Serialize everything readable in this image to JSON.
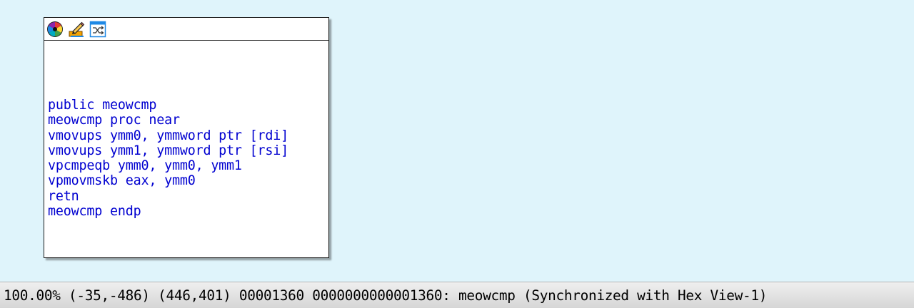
{
  "graph": {
    "node": {
      "header_icons": [
        "color-wheel-icon",
        "edit-pencil-icon",
        "graph-layout-icon"
      ],
      "lines": [
        "public meowcmp",
        "meowcmp proc near",
        "vmovups ymm0, ymmword ptr [rdi]",
        "vmovups ymm1, ymmword ptr [rsi]",
        "vpcmpeqb ymm0, ymm0, ymm1",
        "vpmovmskb eax, ymm0",
        "retn",
        "meowcmp endp"
      ]
    }
  },
  "status_bar": {
    "text": "100.00% (-35,-486) (446,401) 00001360 0000000000001360: meowcmp (Synchronized with Hex View-1)"
  },
  "colors": {
    "background": "#dff4fb",
    "asm_text": "#0000d0",
    "status_bar": "#e4e4e4"
  }
}
